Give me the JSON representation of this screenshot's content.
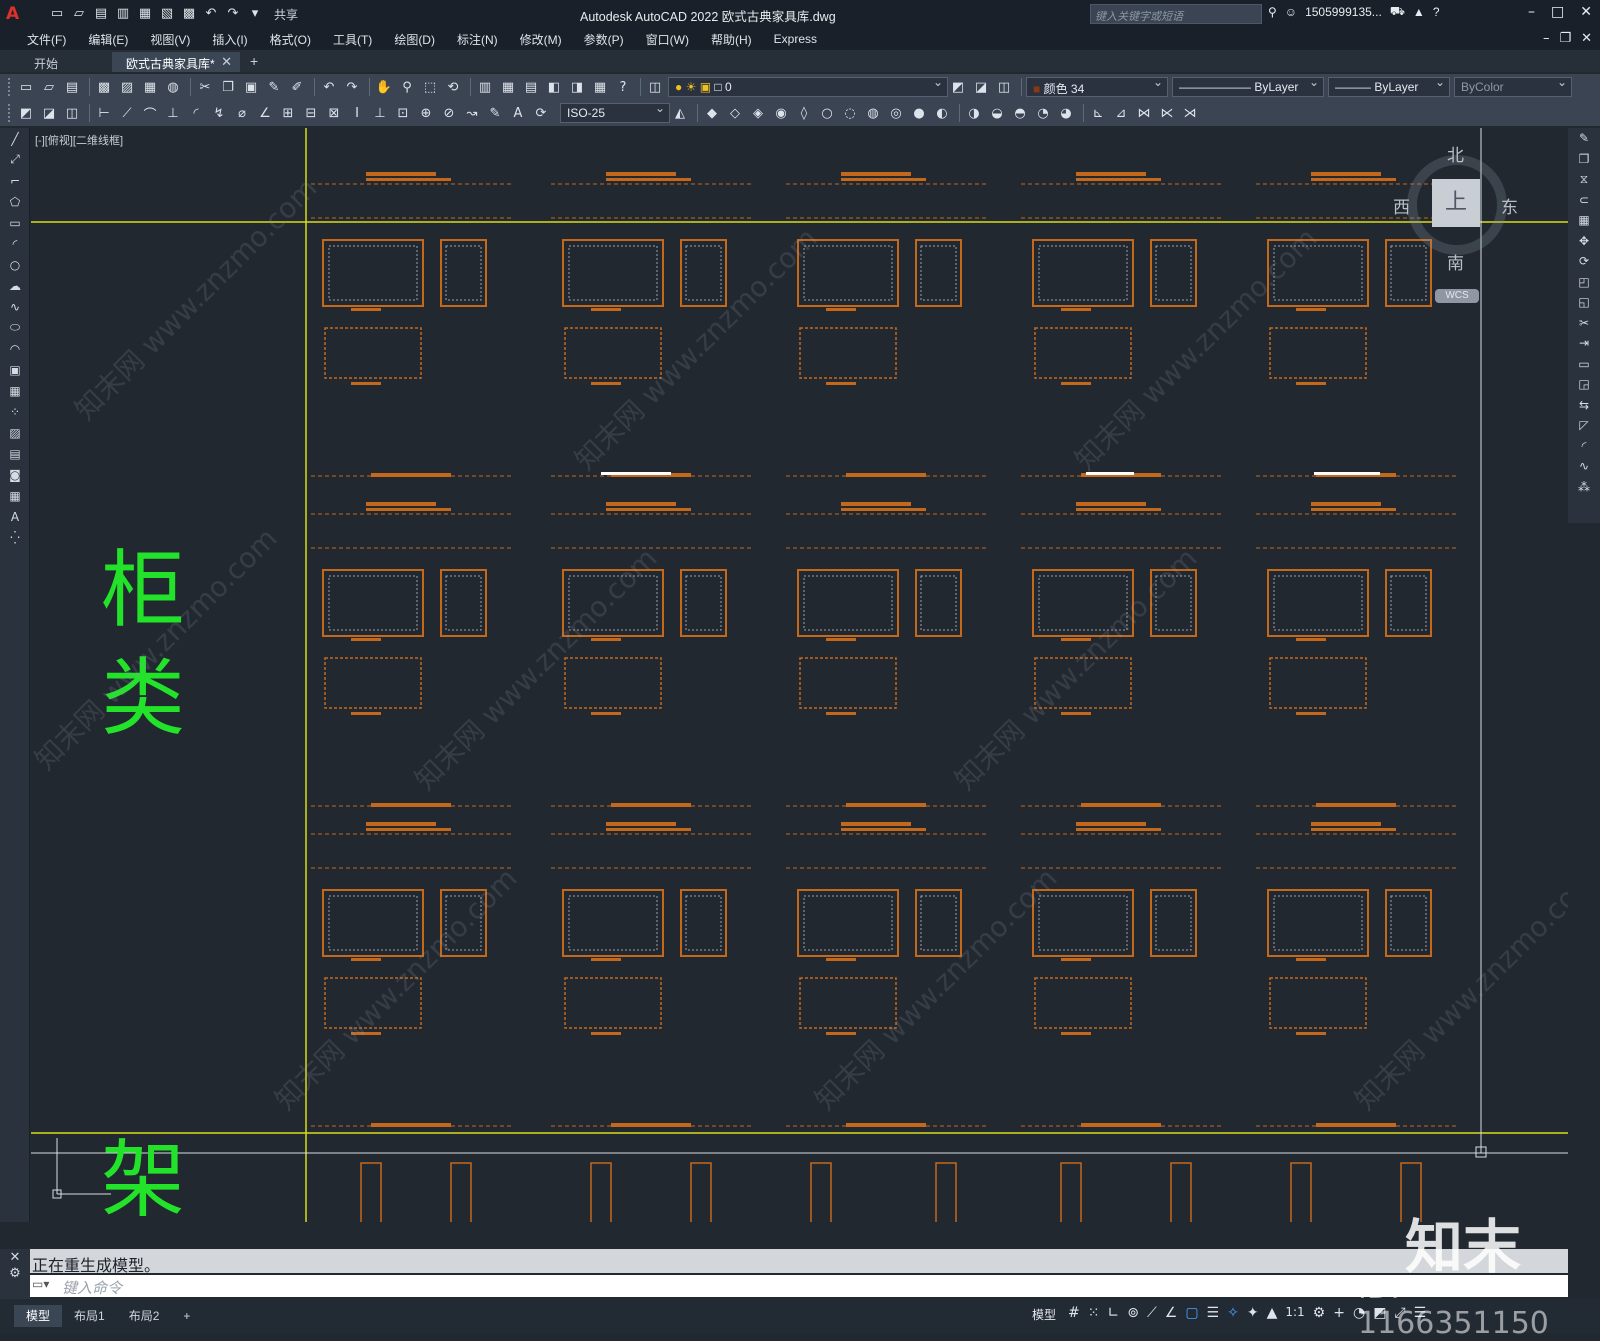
{
  "app": {
    "title": "Autodesk AutoCAD 2022    欧式古典家具库.dwg",
    "logo": "A",
    "share_label": "共享",
    "search_placeholder": "键入关键字或短语",
    "user": "1505999135...",
    "window_controls": [
      "–",
      "□",
      "✕"
    ],
    "doc_controls": [
      "–",
      "❐",
      "✕"
    ]
  },
  "menu": {
    "items": [
      "文件(F)",
      "编辑(E)",
      "视图(V)",
      "插入(I)",
      "格式(O)",
      "工具(T)",
      "绘图(D)",
      "标注(N)",
      "修改(M)",
      "参数(P)",
      "窗口(W)",
      "帮助(H)",
      "Express"
    ]
  },
  "tabs": {
    "start": "开始",
    "active": "欧式古典家具库*",
    "close": "✕",
    "plus": "+"
  },
  "toolbar": {
    "layer_value": "0",
    "color_value": "颜色 34",
    "linetype_value": "ByLayer",
    "lineweight_value": "ByLayer",
    "plotstyle_value": "ByColor",
    "dimstyle_value": "ISO-25"
  },
  "canvas": {
    "viewport_label": "[-][俯视][二维线框]",
    "labels": [
      "柜",
      "类",
      "架"
    ],
    "watermark_site": "知末网 www.znzmo.com",
    "accent_orange": "#c4691c",
    "accent_yellow": "#d8dc1a",
    "label_green": "#22e22a",
    "furniture_gray": "#9aa2ad"
  },
  "viewcube": {
    "north": "北",
    "south": "南",
    "west": "西",
    "east": "东",
    "face": "上",
    "wcs": "WCS"
  },
  "command": {
    "history": "正在重生成模型。",
    "placeholder": "键入命令"
  },
  "status": {
    "layout_tabs": [
      "模型",
      "布局1",
      "布局2"
    ],
    "add_tab": "+",
    "model_label": "模型",
    "scale": "1:1"
  },
  "watermark": {
    "logo": "知末",
    "id": "ID: 1166351150"
  }
}
